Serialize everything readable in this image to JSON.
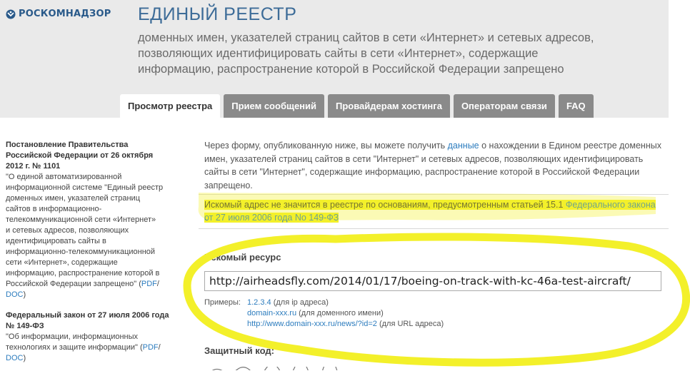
{
  "header": {
    "logo_text": "РОСКОМНАДЗОР",
    "title": "ЕДИНЫЙ РЕЕСТР",
    "subtitle_lines": [
      "доменных имен, указателей страниц сайтов в сети «Интернет» и сетевых адресов,",
      "позволяющих идентифицировать сайты в сети «Интернет», содержащие",
      "информацию, распространение которой в Российской Федерации запрещено"
    ]
  },
  "tabs": [
    {
      "label": "Просмотр реестра",
      "active": true
    },
    {
      "label": "Прием сообщений",
      "active": false
    },
    {
      "label": "Провайдерам хостинга",
      "active": false
    },
    {
      "label": "Операторам связи",
      "active": false
    },
    {
      "label": "FAQ",
      "active": false
    }
  ],
  "sidebar": {
    "blocks": [
      {
        "title_lines": [
          "Постановление Правительства",
          "Российской Федерации от 26 октября",
          "2012 г. № 1101"
        ],
        "body_lines": [
          "\"О единой автоматизированной",
          "информационной системе \"Единый реестр",
          "доменных имен, указателей страниц",
          "сайтов в информационно-",
          "телекоммуникационной сети «Интернет»",
          "и сетевых адресов, позволяющих",
          "идентифицировать сайты в",
          "информационно-телекоммуникационной",
          "сети «Интернет», содержащие",
          "информацию, распространение которой в"
        ],
        "last_line_prefix": "Российской Федерации запрещено\" (",
        "link1": "PDF",
        "sep": "/",
        "link2": "DOC",
        "end": ")"
      },
      {
        "title_lines": [
          "Федеральный закон от 27 июля 2006 года",
          "№ 149-ФЗ"
        ],
        "body_lines": [
          "\"Об информации, информационных"
        ],
        "last_line_prefix": "технологиях и защите информации\" (",
        "link1": "PDF",
        "sep": "/",
        "link2": "DOC",
        "end": ")"
      }
    ]
  },
  "main": {
    "intro_before": "Через форму, опубликованную ниже, вы можете получить ",
    "intro_link": "данные",
    "intro_after": " о нахождении в Едином реестре доменных имен, указателей страниц сайтов в сети \"Интернет\" и сетевых адресов, позволяющих идентифицировать сайты в сети \"Интернет\", содержащие информацию, распространение которой в Российской Федерации запрещено.",
    "notice_text": "Искомый адрес не значится в реестре по основаниям, предусмотренным статьей 15.1 ",
    "notice_link": "Федерального закона от 27 июля 2006 года No 149-ФЗ",
    "resource_label": "Искомый ресурс",
    "resource_value": "http://airheadsfly.com/2014/01/17/boeing-on-track-with-kc-46a-test-aircraft/",
    "examples_label": "Примеры:",
    "examples": [
      {
        "link": "1.2.3.4",
        "note": " (для ip адреса)"
      },
      {
        "link": "domain-xxx.ru",
        "note": " (для доменного имени)"
      },
      {
        "link": "http://www.domain-xxx.ru/news/?id=2",
        "note": " (для URL адреса)"
      }
    ],
    "captcha_label": "Защитный код:"
  },
  "colors": {
    "header_bg": "#eaeaea",
    "title": "#3d6c98",
    "tab_inactive": "#8a8a8a",
    "link": "#2c7cbe",
    "highlight": "#f3f02a"
  }
}
